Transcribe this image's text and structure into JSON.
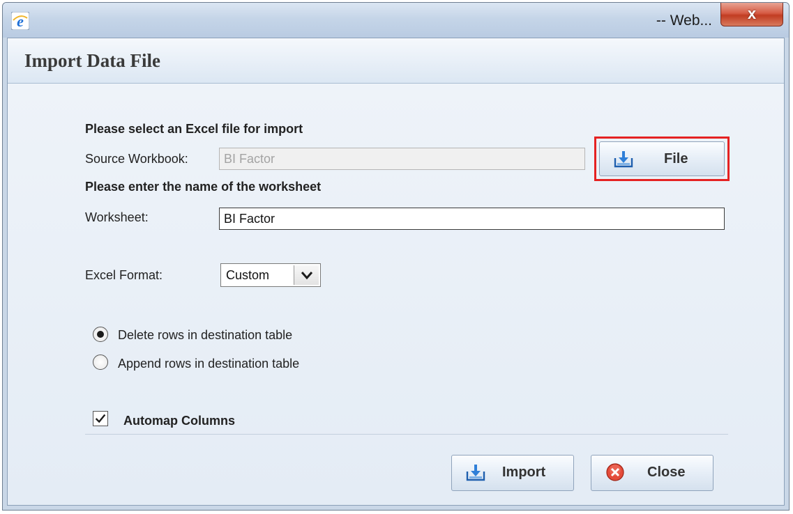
{
  "window": {
    "title": "-- Web...",
    "app_icon": "ie-icon",
    "close_glyph": "x"
  },
  "dialog": {
    "heading": "Import Data File",
    "select_file_prompt": "Please select an Excel file for import",
    "source_workbook_label": "Source Workbook:",
    "source_workbook_value": "BI Factor",
    "file_button_label": "File",
    "worksheet_prompt": "Please enter the name of the worksheet",
    "worksheet_label": "Worksheet:",
    "worksheet_value": "BI Factor",
    "excel_format_label": "Excel Format:",
    "excel_format_value": "Custom",
    "radio_delete_label": "Delete rows in destination table",
    "radio_append_label": "Append rows in destination table",
    "radio_selected": "delete",
    "automap_label": "Automap Columns",
    "automap_checked": true,
    "import_button_label": "Import",
    "close_button_label": "Close"
  },
  "colors": {
    "highlight": "#e52222",
    "accent": "#2f6fb8"
  }
}
